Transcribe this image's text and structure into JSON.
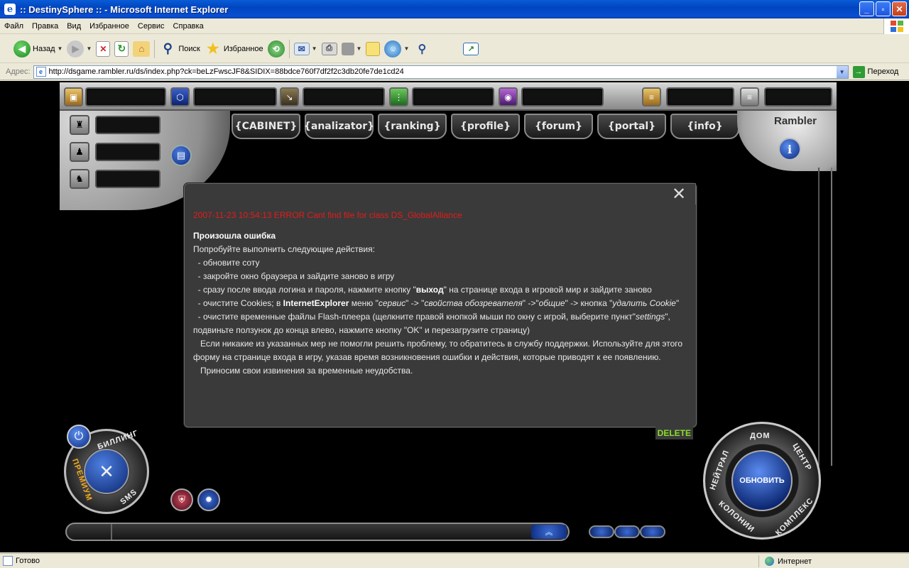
{
  "window": {
    "title": ":: DestinySphere :: - Microsoft Internet Explorer"
  },
  "menu": [
    "Файл",
    "Правка",
    "Вид",
    "Избранное",
    "Сервис",
    "Справка"
  ],
  "toolbar": {
    "back": "Назад",
    "search": "Поиск",
    "favorites": "Избранное"
  },
  "address": {
    "label": "Адрес:",
    "url": "http://dsgame.rambler.ru/ds/index.php?ck=beLzFwscJF8&SIDIX=88bdce760f7df2f2c3db20fe7de1cd24",
    "go": "Переход"
  },
  "game": {
    "tabs": [
      "{CABINET}",
      "{analizator}",
      "{ranking}",
      "{profile}",
      "{forum}",
      "{portal}",
      "{info}"
    ],
    "brand": "Rambler",
    "dialog": {
      "error_line": "2007-11-23 10:54:13 ERROR Cant find file for class DS_GlobalAlliance",
      "heading": "Произошла ошибка",
      "intro": "Попробуйте выполнить следующие действия:",
      "step1": "  - обновите соту",
      "step2": "  - закройте окно браузера и зайдите заново в игру",
      "step3a": "  - сразу после ввода логина и пароля, нажмите кнопку \"",
      "step3b": "выход",
      "step3c": "\" на странице входа в игровой мир и зайдите заново",
      "step4a": "  - очистите Cookies; в ",
      "step4b": "InternetExplorer",
      "step4c": " меню \"",
      "step4d": "сервис",
      "step4e": "\" -> \"",
      "step4f": "свойства обозревателя",
      "step4g": "\" ->\"",
      "step4h": "общие",
      "step4i": "\" -> кнопка \"",
      "step4j": "удалить Cookie",
      "step4k": "\"",
      "step5a": "  - очистите временные файлы Flash-плеера (щелкните правой кнопкой мыши по окну с игрой, выберите пункт\"",
      "step5b": "settings",
      "step5c": "\", подвиньте ползунок до конца влево, нажмите кнопку \"OK\" и перезагрузите страницу)",
      "support": "   Если никакие из указанных мер не помогли решить проблему, то обратитесь в службу поддержки. Используйте для этого форму на странице входа в игру, указав время возникновения ошибки и действия, которые приводят к ее появлению.",
      "apology": "   Приносим свои извинения за временные неудобства.",
      "delete": "DELETE"
    },
    "left_dial": {
      "billing": "БИЛЛИНГ",
      "premium": "ПРЕМИУМ",
      "sms": "SMS"
    },
    "right_dial": {
      "center_button": "ОБНОВИТЬ",
      "dom": "ДОМ",
      "centr": "ЦЕНТР",
      "kompleks": "КОМПЛЕКС",
      "kolonii": "КОЛОНИИ",
      "neitral": "НЕЙТРАЛ"
    }
  },
  "status": {
    "text": "Готово",
    "zone": "Интернет"
  }
}
